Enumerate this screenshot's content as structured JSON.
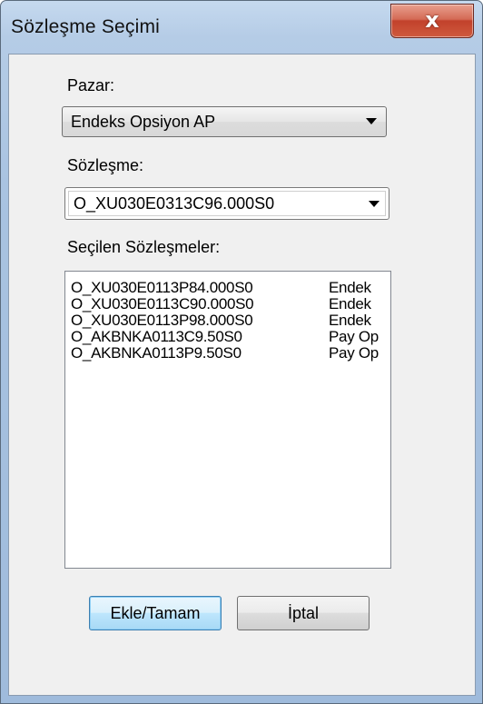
{
  "window": {
    "title": "Sözleşme Seçimi",
    "close_glyph": "x"
  },
  "market": {
    "label": "Pazar:",
    "selected": "Endeks Opsiyon AP"
  },
  "contract": {
    "label": "Sözleşme:",
    "selected": "O_XU030E0313C96.000S0"
  },
  "selected_contracts": {
    "label": "Seçilen Sözleşmeler:",
    "rows": [
      {
        "code": "O_XU030E0113P84.000S0",
        "type": "Endek"
      },
      {
        "code": "O_XU030E0113C90.000S0",
        "type": "Endek"
      },
      {
        "code": "O_XU030E0113P98.000S0",
        "type": "Endek"
      },
      {
        "code": "O_AKBNKA0113C9.50S0",
        "type": "Pay Op"
      },
      {
        "code": "O_AKBNKA0113P9.50S0",
        "type": "Pay Op"
      }
    ]
  },
  "buttons": {
    "add_ok": "Ekle/Tamam",
    "cancel": "İptal"
  }
}
